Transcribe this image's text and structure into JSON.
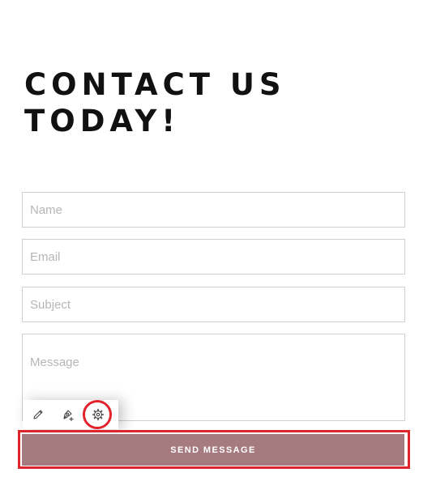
{
  "heading": {
    "line1": "CONTACT US",
    "line2": "TODAY!"
  },
  "form": {
    "name_placeholder": "Name",
    "email_placeholder": "Email",
    "subject_placeholder": "Subject",
    "message_placeholder": "Message",
    "submit_label": "SEND MESSAGE"
  },
  "toolbar": {
    "icons": [
      "pencil-icon",
      "pen-plus-icon",
      "gear-icon"
    ]
  },
  "colors": {
    "submit_bg": "#a57b80",
    "highlight": "#e0242c",
    "field_border": "#cfcfcf",
    "placeholder": "#b6b6b6"
  }
}
